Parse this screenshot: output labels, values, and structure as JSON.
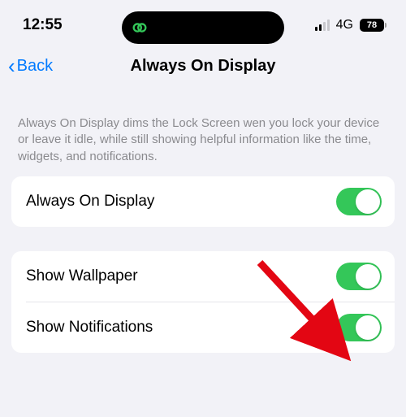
{
  "status": {
    "time": "12:55",
    "network": "4G",
    "battery_pct": "78"
  },
  "nav": {
    "back_label": "Back",
    "title": "Always On Display"
  },
  "description": "Always On Display dims the Lock Screen wen you lock your device or leave it idle, while still showing helpful information like the time, widgets, and notifications.",
  "group1": {
    "row1": {
      "label": "Always On Display",
      "on": true
    }
  },
  "group2": {
    "row1": {
      "label": "Show Wallpaper",
      "on": true
    },
    "row2": {
      "label": "Show Notifications",
      "on": true
    }
  }
}
